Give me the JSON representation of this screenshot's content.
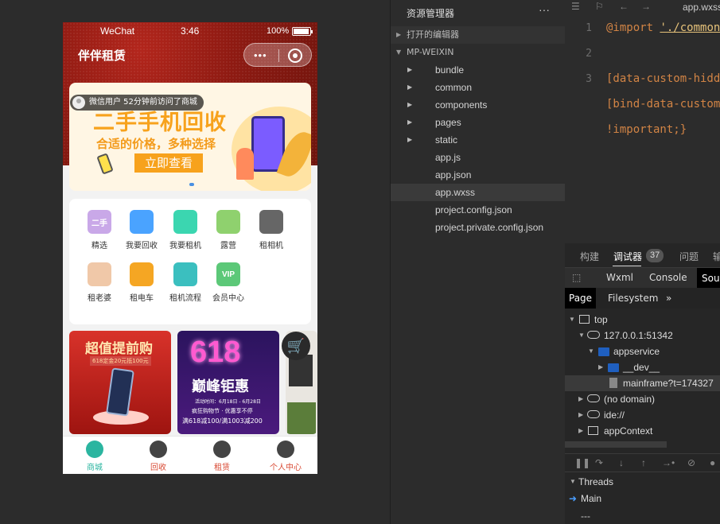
{
  "phone": {
    "status": {
      "carrier": "WeChat",
      "time": "3:46",
      "battery": "100%"
    },
    "app_title": "伴伴租赁",
    "banner": {
      "visit_notice": "微信用户 52分钟前访问了商城",
      "headline": "二手手机回收",
      "subline": "合适的价格，多种选择",
      "cta": "立即查看"
    },
    "grid": [
      {
        "label": "精选",
        "icon": "box-icon",
        "glyph": "二手",
        "color": "#c9a8e8"
      },
      {
        "label": "我要回收",
        "icon": "cube-icon",
        "glyph": "",
        "color": "#4aa3ff"
      },
      {
        "label": "我要租机",
        "icon": "phone-icon",
        "glyph": "",
        "color": "#3bd6b0"
      },
      {
        "label": "露营",
        "icon": "tent-icon",
        "glyph": "",
        "color": "#8fd16e"
      },
      {
        "label": "租相机",
        "icon": "camera-icon",
        "glyph": "",
        "color": "#666666"
      },
      {
        "label": "租老婆",
        "icon": "person-icon",
        "glyph": "",
        "color": "#f0c8a8"
      },
      {
        "label": "租电车",
        "icon": "scooter-icon",
        "glyph": "",
        "color": "#f5a623"
      },
      {
        "label": "租机流程",
        "icon": "list-icon",
        "glyph": "",
        "color": "#3bbfbf"
      },
      {
        "label": "会员中心",
        "icon": "vip-icon",
        "glyph": "VIP",
        "color": "#5cc878"
      }
    ],
    "promos": {
      "card1": {
        "title": "超值提前购",
        "sub": "618定金20元抵100元"
      },
      "card2": {
        "number": "618",
        "title": "巅峰钜惠",
        "line1": "活动时间：6月18日 - 6月28日",
        "line2": "疯狂购物节 · 优惠享不停",
        "line3": "满618减100/满1003减200"
      }
    },
    "tabs": [
      {
        "label": "商城",
        "icon": "home-icon",
        "color": "#2bb5a0",
        "active": true
      },
      {
        "label": "回收",
        "icon": "recycle-icon",
        "color": "#d94b35",
        "active": false
      },
      {
        "label": "租赁",
        "icon": "lease-icon",
        "color": "#d94b35",
        "active": false
      },
      {
        "label": "个人中心",
        "icon": "user-icon",
        "color": "#d94b35",
        "active": false
      }
    ]
  },
  "explorer": {
    "title": "资源管理器",
    "more": "···",
    "open_editors": "打开的编辑器",
    "project": "MP-WEIXIN",
    "folders": [
      "bundle",
      "common",
      "components",
      "pages",
      "static"
    ],
    "files": [
      "app.js",
      "app.json",
      "app.wxss",
      "project.config.json",
      "project.private.config.json"
    ],
    "selected": "app.wxss"
  },
  "editor": {
    "filename": "app.wxss",
    "lines": [
      {
        "num": "1",
        "text_kw": "@import ",
        "text_str": "'./common"
      },
      {
        "num": "2",
        "text_kw": "",
        "text_str": ""
      },
      {
        "num": "3",
        "text_kw": "[data-custom-hidd",
        "text_str": ""
      },
      {
        "num": "",
        "text_kw": "[bind-data-custom",
        "text_str": ""
      },
      {
        "num": "",
        "text_kw": "!important;}",
        "text_str": ""
      }
    ]
  },
  "devtools": {
    "tabs": [
      "构建",
      "调试器",
      "问题",
      "输"
    ],
    "badge": "37",
    "subtabs": [
      "Wxml",
      "Console",
      "Sour"
    ],
    "pagetabs": [
      "Page",
      "Filesystem",
      "»"
    ],
    "tree": [
      "top",
      "127.0.0.1:51342",
      "appservice",
      "__dev__",
      "mainframe?t=174327",
      "(no domain)",
      "ide://",
      "appContext"
    ],
    "threads": "Threads",
    "main": "Main",
    "dashes": "---"
  }
}
